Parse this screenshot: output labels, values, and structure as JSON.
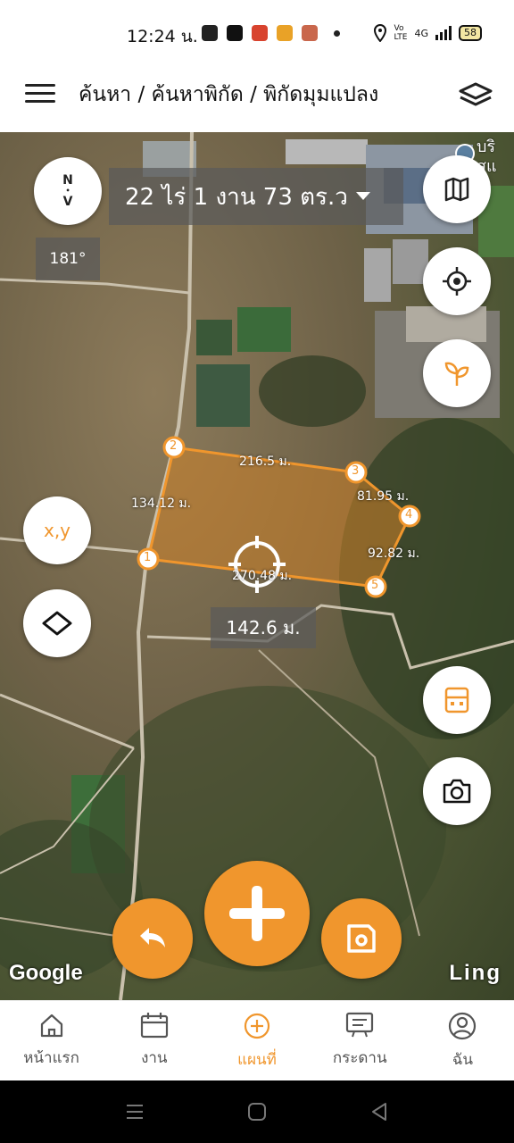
{
  "status_bar": {
    "time": "12:24 น.",
    "battery": "58",
    "network": "4G"
  },
  "header": {
    "breadcrumb": "ค้นหา / ค้นหาพิกัด / พิกัดมุมแปลง"
  },
  "map": {
    "area_text": "22 ไร่ 1 งาน 73 ตร.ว",
    "bearing": "181°",
    "compass_n": "N",
    "compass_v": "V",
    "xy_label": "x,y",
    "distance_total": "142.6 ม.",
    "poi_label_1": "บริ",
    "poi_label_2": "สแ",
    "google_label": "Google",
    "ling_label": "Ling",
    "points": [
      "1",
      "2",
      "3",
      "4",
      "5"
    ],
    "segments": {
      "s12": "134.12 ม.",
      "s23": "216.5 ม.",
      "s34": "81.95 ม.",
      "s45": "92.82 ม.",
      "s51": "270.48 ม."
    },
    "accent_color": "#f0962d"
  },
  "bottom_nav": {
    "items": [
      {
        "label": "หน้าแรก",
        "icon": "home-icon"
      },
      {
        "label": "งาน",
        "icon": "calendar-icon"
      },
      {
        "label": "แผนที่",
        "icon": "add-circle-icon"
      },
      {
        "label": "กระดาน",
        "icon": "board-icon"
      },
      {
        "label": "ฉัน",
        "icon": "profile-icon"
      }
    ],
    "active_index": 2
  }
}
